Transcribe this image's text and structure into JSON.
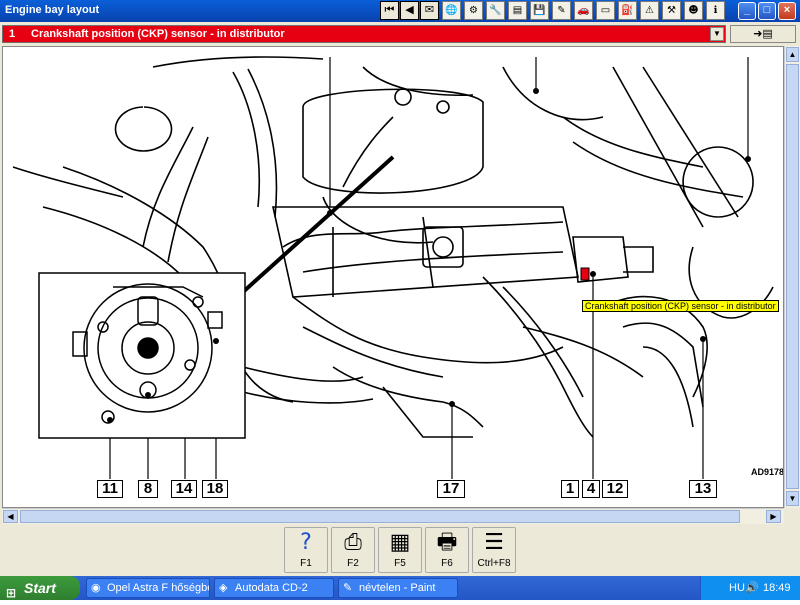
{
  "window": {
    "title": "Engine bay layout",
    "toolbar_icons": [
      "first-page-icon",
      "previous-page-icon",
      "next-page-icon",
      "last-page-icon",
      "document-icon",
      "globe-icon",
      "tools-icon",
      "wrench-icon",
      "settings-icon",
      "save-icon",
      "edit-icon",
      "car-icon",
      "battery-icon",
      "fuel-icon",
      "warning-icon",
      "engine-icon",
      "calculator-icon",
      "person-icon",
      "info-icon",
      "help-icon"
    ]
  },
  "component_select": {
    "number": "1",
    "label": "Crankshaft position (CKP) sensor - in distributor"
  },
  "diagram": {
    "tooltip": "Crankshaft position (CKP) sensor - in distributor",
    "reference": "AD9178",
    "callouts": [
      "11",
      "8",
      "14",
      "18",
      "17",
      "1",
      "4",
      "12",
      "13"
    ]
  },
  "function_keys": [
    {
      "key": "F1",
      "icon": "help-icon"
    },
    {
      "key": "F2",
      "icon": "print-icon"
    },
    {
      "key": "F5",
      "icon": "page-icon"
    },
    {
      "key": "F6",
      "icon": "printer-icon"
    },
    {
      "key": "Ctrl+F8",
      "icon": "table-icon"
    }
  ],
  "taskbar": {
    "start_label": "Start",
    "tasks": [
      "Opel Astra F hőségbe...",
      "Autodata CD-2",
      "névtelen - Paint"
    ],
    "language": "HU",
    "clock": "18:49"
  },
  "colors": {
    "accent": "#e60012",
    "tooltip_bg": "#ffff00",
    "titlebar": "#0a5fd8"
  }
}
